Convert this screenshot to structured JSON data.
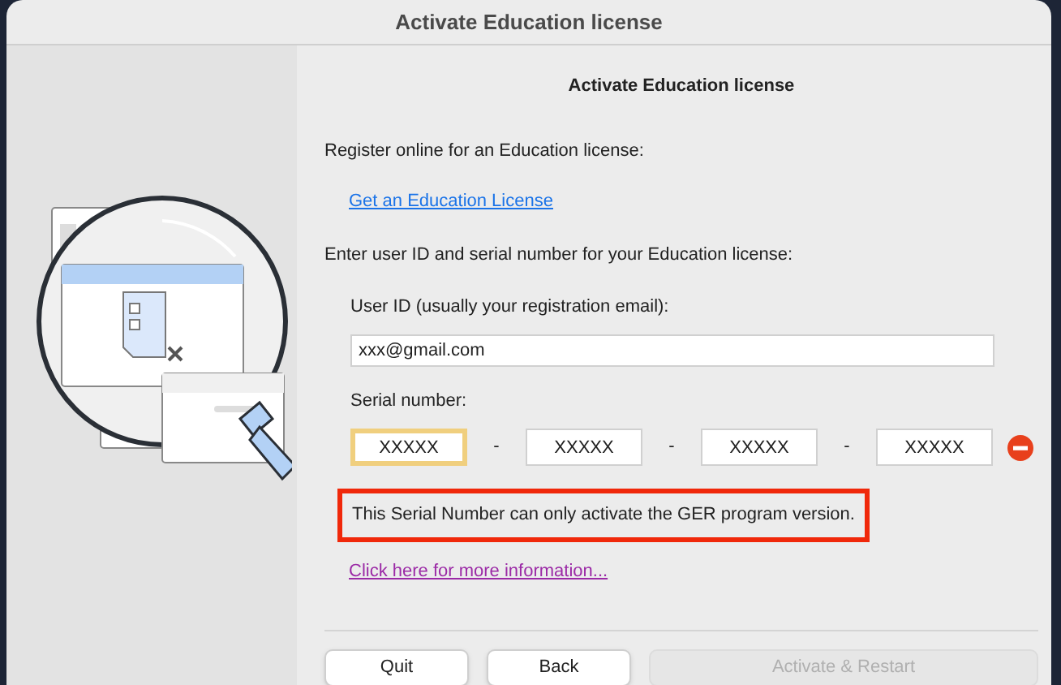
{
  "window": {
    "title": "Activate Education license"
  },
  "heading": "Activate Education license",
  "register_label": "Register online for an Education license:",
  "register_link": "Get an Education License",
  "instructions": "Enter user ID and serial number for your Education license:",
  "user_id": {
    "label": "User ID (usually your registration email):",
    "value": "xxx@gmail.com"
  },
  "serial": {
    "label": "Serial number:",
    "error": true,
    "parts": [
      {
        "value": "XXXXX",
        "focused": true
      },
      {
        "value": "XXXXX",
        "focused": false
      },
      {
        "value": "XXXXX",
        "focused": false
      },
      {
        "value": "XXXXX",
        "focused": false
      }
    ],
    "separators": [
      "-",
      "-",
      "-"
    ]
  },
  "message": {
    "text": "This Serial Number can only activate the GER program version.",
    "highlighted": true
  },
  "info_link": "Click here for more information...",
  "buttons": [
    {
      "label": "Quit",
      "disabled": false
    },
    {
      "label": "Back",
      "disabled": false
    },
    {
      "label": "Activate & Restart",
      "disabled": true
    }
  ]
}
